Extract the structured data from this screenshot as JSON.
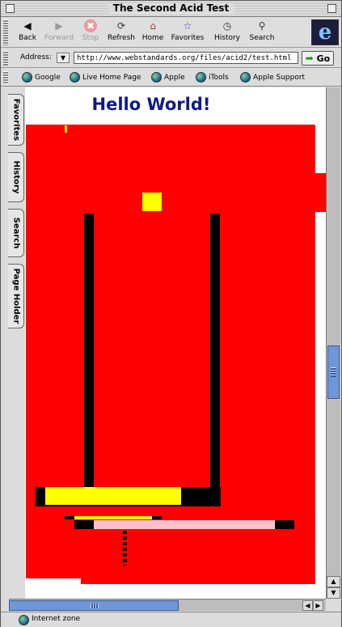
{
  "window": {
    "title": "The Second Acid Test"
  },
  "toolbar": {
    "back": "Back",
    "forward": "Forward",
    "stop": "Stop",
    "refresh": "Refresh",
    "home": "Home",
    "favorites": "Favorites",
    "history": "History",
    "search": "Search",
    "logo": "e"
  },
  "address": {
    "label": "Address:",
    "url": "http://www.webstandards.org/files/acid2/test.html",
    "go_label": "Go"
  },
  "favorites_bar": [
    "Google",
    "Live Home Page",
    "Apple",
    "iTools",
    "Apple Support"
  ],
  "side_tabs": [
    "Favorites",
    "History",
    "Search",
    "Page Holder"
  ],
  "page": {
    "heading": "Hello World!"
  },
  "status": {
    "zone": "Internet zone"
  },
  "colors": {
    "heading": "#0d1a8a",
    "red": "#ff0000",
    "yellow": "#ffff00",
    "pink": "#ffc0cb",
    "scroll_thumb": "#6f97d8"
  }
}
